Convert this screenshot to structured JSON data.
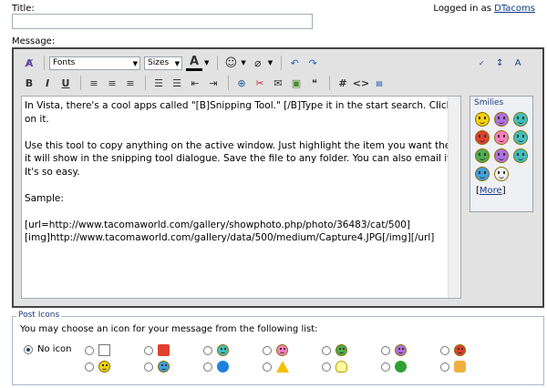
{
  "colors": {
    "accent": "#1a3c82",
    "link": "#0a3c8c",
    "panel": "#e2e2e2",
    "yellow": "#f5d20a",
    "red": "#e04030",
    "purple": "#b070e0",
    "green": "#4caf50",
    "teal": "#40c0c0",
    "pink": "#ff80c0"
  },
  "header": {
    "title_label": "Title:",
    "logged_prefix": "Logged in as",
    "username": "DTacoms",
    "message_label": "Message:"
  },
  "toolbar": {
    "font_select": "Fonts",
    "size_select": "Sizes",
    "font_color_label": "A",
    "bold": "B",
    "italic": "I",
    "underline": "U",
    "hash": "#",
    "code": "<>"
  },
  "message_text": "In Vista, there's a cool apps called \"[B]Snipping Tool.\" [/B]Type it in the start search. Click on it.\n\nUse this tool to copy anything on the active window. Just highlight the item you want then it will show in the snipping tool dialogue. Save the file to any folder. You can also email it! It's so easy.\n\nSample:\n\n[url=http://www.tacomaworld.com/gallery/showphoto.php/photo/36483/cat/500][img]http://www.tacomaworld.com/gallery/data/500/medium/Capture4.JPG[/img][/url]",
  "smilies": {
    "title": "Smilies",
    "more_open": "[",
    "more": "More",
    "more_close": "]"
  },
  "post_icons": {
    "legend": "Post Icons",
    "description": "You may choose an icon for your message from the following list:",
    "no_icon": "No icon"
  }
}
